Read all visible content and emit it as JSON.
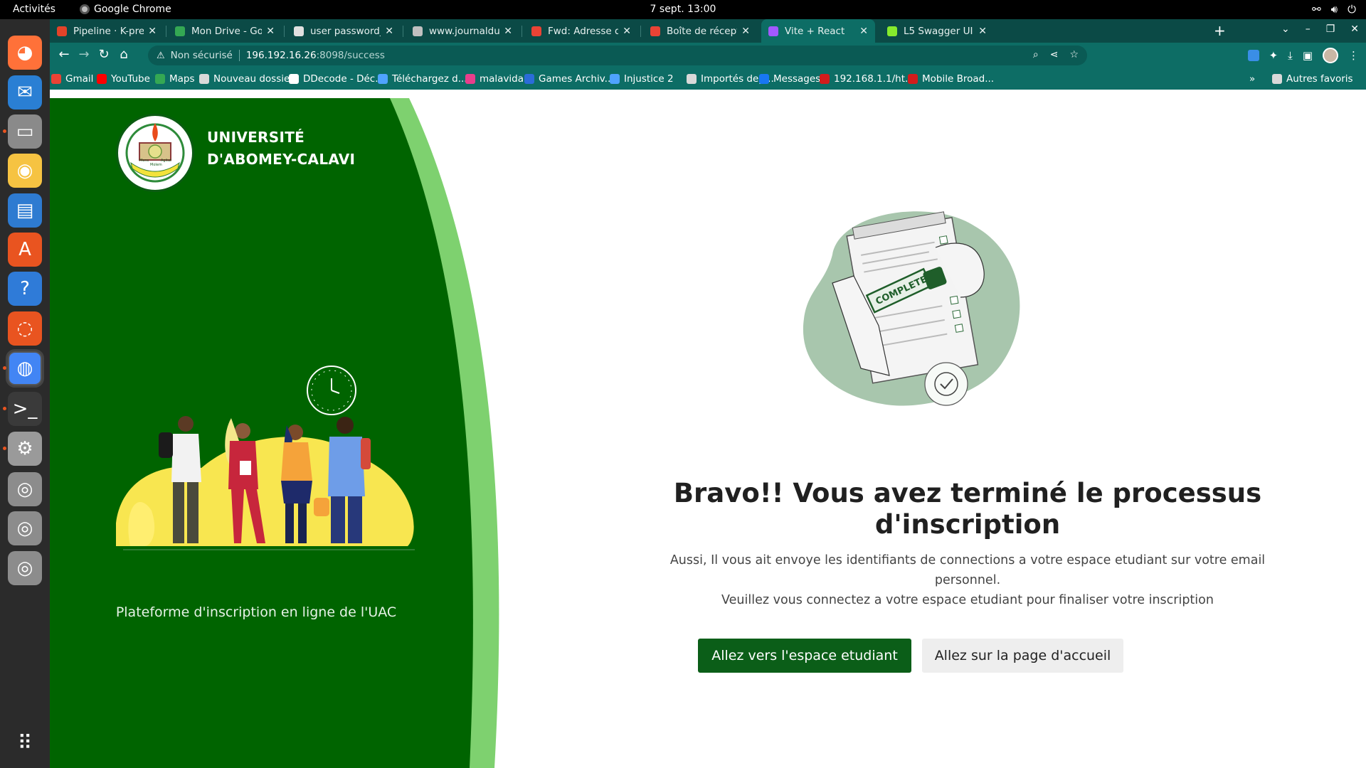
{
  "topbar": {
    "activities": "Activités",
    "app_name": "Google Chrome",
    "clock": "7 sept.  13:00",
    "tray_icons": [
      "network-icon",
      "volume-icon",
      "power-icon"
    ]
  },
  "dock": {
    "items": [
      {
        "name": "firefox-icon",
        "color": "#ff7139"
      },
      {
        "name": "thunderbird-icon",
        "color": "#2a7fd4"
      },
      {
        "name": "files-icon",
        "color": "#8a8a8a"
      },
      {
        "name": "rhythmbox-icon",
        "color": "#f6c342"
      },
      {
        "name": "writer-icon",
        "color": "#2e7bd1"
      },
      {
        "name": "software-icon",
        "color": "#e95420"
      },
      {
        "name": "help-icon",
        "color": "#2f7bd8"
      },
      {
        "name": "ubuntu-one-icon",
        "color": "#e95420"
      },
      {
        "name": "chrome-icon",
        "color": "#4285f4"
      },
      {
        "name": "terminal-icon",
        "color": "#3a3a3a"
      },
      {
        "name": "settings-icon",
        "color": "#9a9a9a"
      },
      {
        "name": "disk-icon-1",
        "color": "#8c8c8c"
      },
      {
        "name": "disk-icon-2",
        "color": "#8c8c8c"
      },
      {
        "name": "disk-icon-3",
        "color": "#8c8c8c"
      }
    ],
    "show_apps": "show-apps-icon"
  },
  "tabs": [
    {
      "title": "Pipeline · K-preinscri",
      "icon": "gitlab-icon",
      "color": "#e24329"
    },
    {
      "title": "Mon Drive - Google D",
      "icon": "drive-icon",
      "color": "#34a853"
    },
    {
      "title": "user password_sdep",
      "icon": "doc-icon",
      "color": "#e0e0e0"
    },
    {
      "title": "www.journaldunet.f",
      "icon": "globe-icon",
      "color": "#c0c0c0"
    },
    {
      "title": "Fwd: Adresse de cor",
      "icon": "gmail-icon",
      "color": "#ea4335"
    },
    {
      "title": "Boîte de réception (",
      "icon": "gmail-icon",
      "color": "#ea4335"
    },
    {
      "title": "Vite + React",
      "icon": "vite-icon",
      "color": "#a259ff"
    },
    {
      "title": "L5 Swagger UI",
      "icon": "swagger-icon",
      "color": "#85ea2d"
    }
  ],
  "toolbar": {
    "security_label": "Non sécurisé",
    "url_host": "196.192.16.26",
    "url_path": ":8098/success"
  },
  "bookmarks": [
    {
      "label": "Gmail",
      "color": "#ea4335"
    },
    {
      "label": "YouTube",
      "color": "#ff0000"
    },
    {
      "label": "Maps",
      "color": "#34a853"
    },
    {
      "label": "Nouveau dossier",
      "color": "#d9d9d9"
    },
    {
      "label": "DDecode - Déc...",
      "color": "#ffffff"
    },
    {
      "label": "Téléchargez d...",
      "color": "#4fa3ff"
    },
    {
      "label": "malavida",
      "color": "#e83e8c"
    },
    {
      "label": "Games Archiv...",
      "color": "#2b6cd9"
    },
    {
      "label": "Injustice 2",
      "color": "#4fa3ff"
    },
    {
      "label": "Importés dep...",
      "color": "#d9d9d9"
    },
    {
      "label": "Messages",
      "color": "#1877f2"
    },
    {
      "label": "192.168.1.1/ht...",
      "color": "#d11c1c"
    },
    {
      "label": "Mobile Broad...",
      "color": "#d11c1c"
    }
  ],
  "bookmarks_overflow": "»",
  "other_bookmarks": "Autres favoris",
  "page": {
    "university_name_line1": "UNIVERSITÉ",
    "university_name_line2": "D'ABOMEY-CALAVI",
    "logo_text": "UNIVERSITÉ D'ABOMEY-CALAVI",
    "logo_motto_left": "Mens",
    "logo_motto_right": "Agitat",
    "logo_motto_bottom": "Molem",
    "platform_caption": "Plateforme d'inscription en ligne de l'UAC",
    "stamp_text": "COMPLETE",
    "headline": "Bravo!! Vous avez terminé le processus d'inscription",
    "message_line1": "Aussi, Il vous ait envoye les identifiants de connections a votre espace etudiant sur votre email personnel.",
    "message_line2": "Veuillez vous connectez a votre espace etudiant pour finaliser votre inscription",
    "btn_student": "Allez vers l'espace etudiant",
    "btn_home": "Allez sur la page d'accueil"
  },
  "colors": {
    "panel_green": "#006400",
    "accent_light_green": "#7ed16f",
    "primary_button": "#0b5e18",
    "browser_chrome": "#0d6d65"
  }
}
